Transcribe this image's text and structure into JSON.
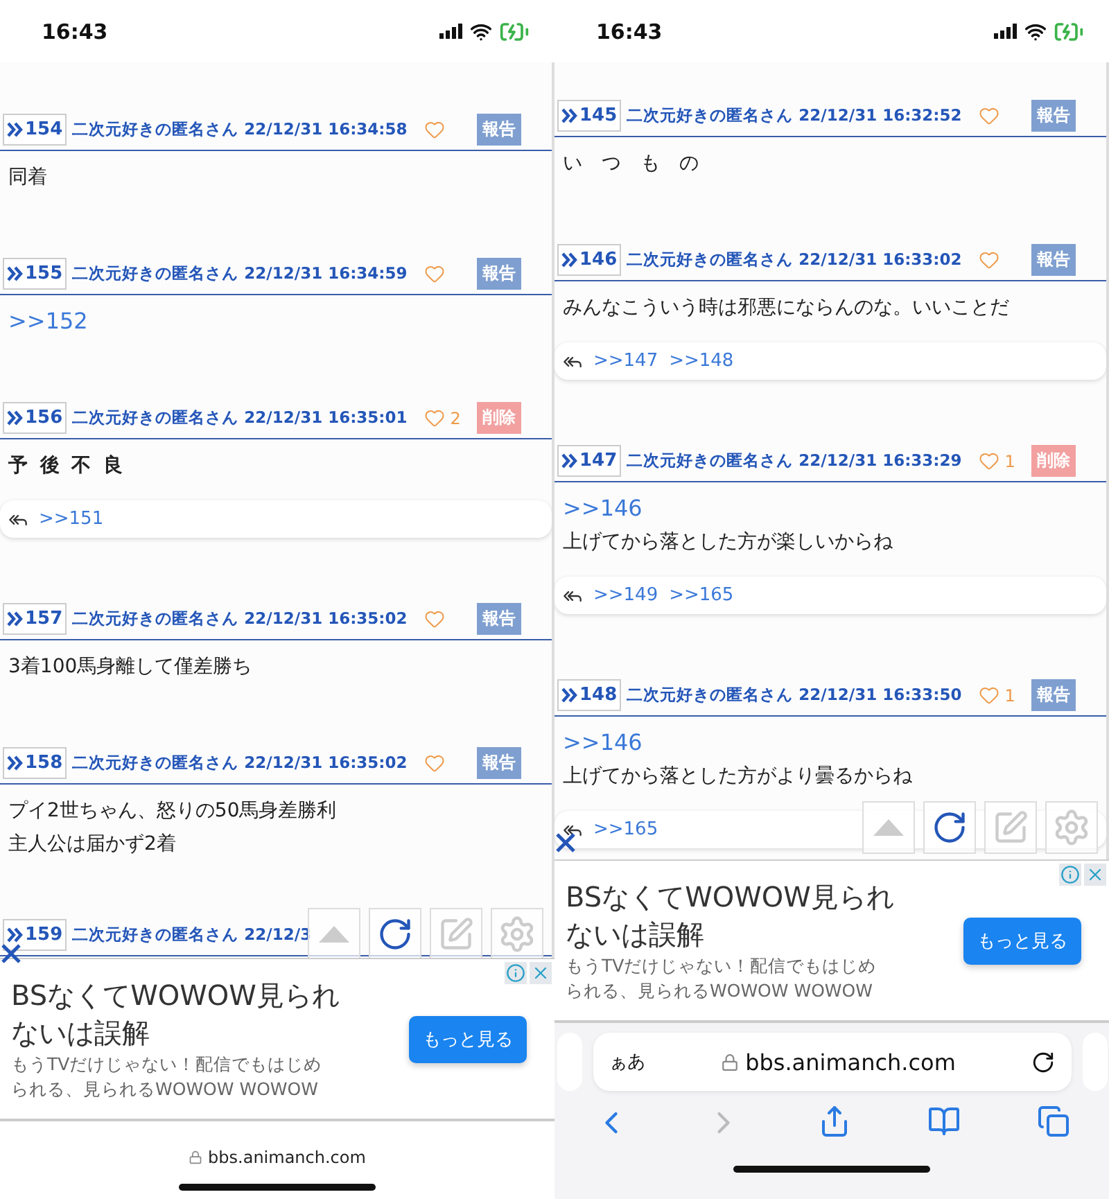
{
  "phones": [
    {
      "status_bar": {
        "time": "16:43"
      },
      "posts": [
        {
          "number": "154",
          "author": "二次元好きの匿名さん",
          "date": "22/12/31 16:34:58",
          "action": {
            "kind": "report",
            "label": "報告"
          },
          "body": [
            {
              "kind": "text",
              "text": "同着"
            }
          ]
        },
        {
          "number": "155",
          "author": "二次元好きの匿名さん",
          "date": "22/12/31 16:34:59",
          "action": {
            "kind": "report",
            "label": "報告"
          },
          "body": [
            {
              "kind": "anchor",
              "text": ">>152"
            }
          ]
        },
        {
          "number": "156",
          "author": "二次元好きの匿名さん",
          "date": "22/12/31 16:35:01",
          "likes": "2",
          "action": {
            "kind": "delete",
            "label": "削除"
          },
          "body": [
            {
              "kind": "strong",
              "text": "予 後 不 良"
            }
          ],
          "replies": [
            ">>151"
          ]
        },
        {
          "number": "157",
          "author": "二次元好きの匿名さん",
          "date": "22/12/31 16:35:02",
          "action": {
            "kind": "report",
            "label": "報告"
          },
          "body": [
            {
              "kind": "text",
              "text": "3着100馬身離して僅差勝ち"
            }
          ]
        },
        {
          "number": "158",
          "author": "二次元好きの匿名さん",
          "date": "22/12/31 16:35:02",
          "action": {
            "kind": "report",
            "label": "報告"
          },
          "body": [
            {
              "kind": "text",
              "text": "プイ2世ちゃん、怒りの50馬身差勝利"
            },
            {
              "kind": "text",
              "text": "主人公は届かず2着"
            }
          ]
        },
        {
          "number": "159",
          "author": "二次元好きの匿名さん",
          "date": "22/12/3"
        }
      ],
      "ad": {
        "headline": [
          "BSなくてWOWOW見られ",
          "ないは誤解"
        ],
        "body": [
          "もうTVだけじゃない！配信でもはじめ",
          "られる、見られるWOWOW WOWOW"
        ],
        "button": "もっと見る"
      },
      "browser": {
        "kind": "compact",
        "url": "bbs.animanch.com"
      }
    },
    {
      "status_bar": {
        "time": "16:43"
      },
      "posts": [
        {
          "number": "145",
          "author": "二次元好きの匿名さん",
          "date": "22/12/31 16:32:52",
          "action": {
            "kind": "report",
            "label": "報告"
          },
          "body": [
            {
              "kind": "text",
              "text": "い　つ　も　の"
            }
          ]
        },
        {
          "number": "146",
          "author": "二次元好きの匿名さん",
          "date": "22/12/31 16:33:02",
          "action": {
            "kind": "report",
            "label": "報告"
          },
          "body": [
            {
              "kind": "text",
              "text": "みんなこういう時は邪悪にならんのな。いいことだ"
            }
          ],
          "replies": [
            ">>147",
            ">>148"
          ]
        },
        {
          "number": "147",
          "author": "二次元好きの匿名さん",
          "date": "22/12/31 16:33:29",
          "likes": "1",
          "action": {
            "kind": "delete",
            "label": "削除"
          },
          "body": [
            {
              "kind": "anchor",
              "text": ">>146"
            },
            {
              "kind": "text",
              "text": "上げてから落とした方が楽しいからね"
            }
          ],
          "replies": [
            ">>149",
            ">>165"
          ]
        },
        {
          "number": "148",
          "author": "二次元好きの匿名さん",
          "date": "22/12/31 16:33:50",
          "likes": "1",
          "action": {
            "kind": "report",
            "label": "報告"
          },
          "body": [
            {
              "kind": "anchor",
              "text": ">>146"
            },
            {
              "kind": "text",
              "text": "上げてから落とした方がより曇るからね"
            }
          ],
          "replies": [
            ">>165"
          ]
        }
      ],
      "ad": {
        "headline": [
          "BSなくてWOWOW見られ",
          "ないは誤解"
        ],
        "body": [
          "もうTVだけじゃない！配信でもはじめ",
          "られる、見られるWOWOW WOWOW"
        ],
        "button": "もっと見る"
      },
      "browser": {
        "kind": "full",
        "text_size": "ぁあ",
        "url": "bbs.animanch.com"
      }
    }
  ]
}
